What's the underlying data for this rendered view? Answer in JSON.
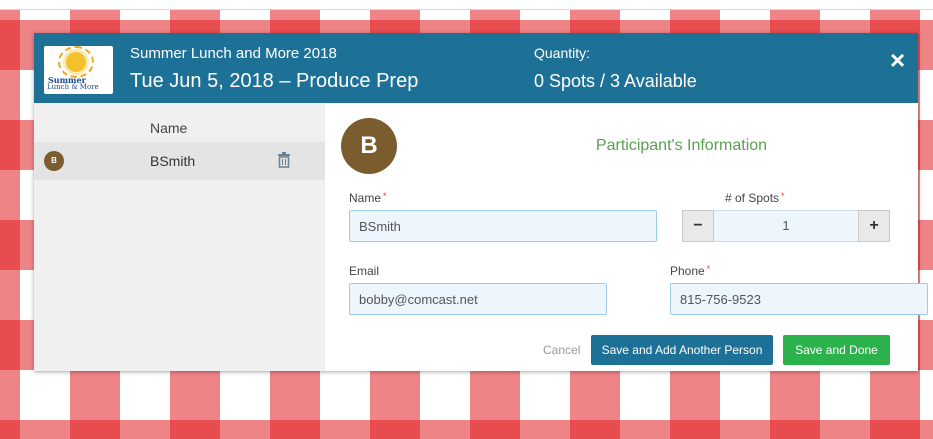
{
  "header": {
    "logo_line1": "Summer",
    "logo_line2": "Lunch & More",
    "title": "Summer Lunch and More 2018",
    "event": "Tue Jun 5, 2018 – Produce Prep",
    "quantity_label": "Quantity:",
    "quantity_value": "0 Spots / 3 Available",
    "close_icon": "×"
  },
  "participants": {
    "column_header": "Name",
    "rows": [
      {
        "initial": "B",
        "name": "BSmith",
        "delete_icon": "trash-icon"
      }
    ]
  },
  "form": {
    "avatar_initial": "B",
    "title": "Participant's Information",
    "name_label": "Name",
    "name_value": "BSmith",
    "spots_label": "# of Spots",
    "spots_value": "1",
    "minus": "−",
    "plus": "+",
    "email_label": "Email",
    "email_value": "bobby@comcast.net",
    "phone_label": "Phone",
    "phone_value": "815-756-9523",
    "required_mark": "*"
  },
  "actions": {
    "cancel": "Cancel",
    "save_add": "Save and Add Another Person",
    "save_done": "Save and Done"
  },
  "colors": {
    "header": "#1e7196",
    "save_done": "#2bb24c",
    "accent_title": "#5ba052",
    "avatar": "#7a5c2f"
  }
}
